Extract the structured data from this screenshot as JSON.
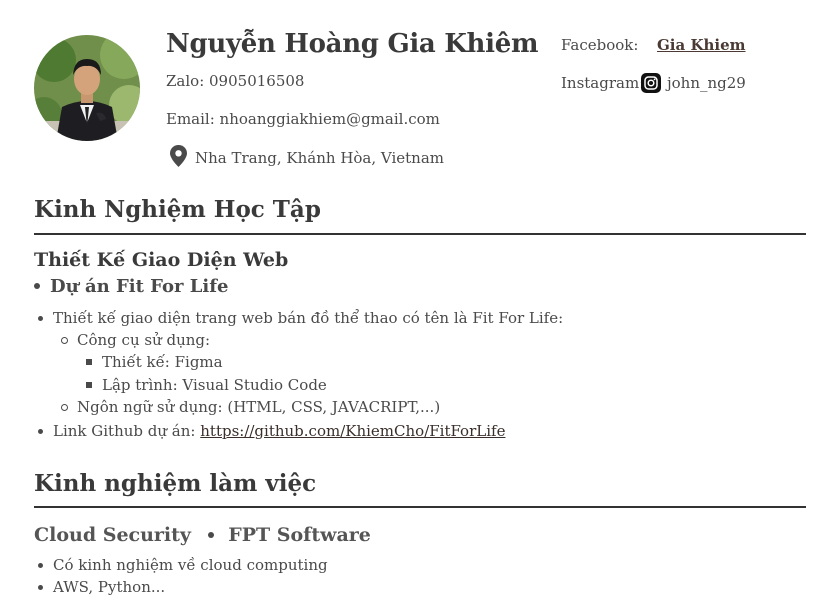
{
  "profile": {
    "name": "Nguyễn Hoàng Gia Khiêm",
    "zalo": "Zalo: 0905016508",
    "email": "Email: nhoanggiakhiem@gmail.com",
    "location": "Nha Trang, Khánh Hòa, Vietnam",
    "facebook_label": "Facebook:",
    "facebook_value": "Gia Khiem",
    "instagram_label": "Instagram:",
    "instagram_value": "john_ng29"
  },
  "education": {
    "title": "Kinh Nghiệm Học Tập",
    "subtitle": "Thiết Kế Giao Diện Web",
    "project": "Dự án Fit For Life",
    "items": {
      "desc": "Thiết kế giao diện trang web bán đồ thể thao có tên là Fit For Life:",
      "tools": "Công cụ sử dụng:",
      "tool_design": "Thiết kế: Figma",
      "tool_code": "Lập trình: Visual Studio Code",
      "languages": "Ngôn ngữ sử dụng: (HTML, CSS, JAVACRIPT,...)",
      "github_label": "Link Github dự án:",
      "github_url": "https://github.com/KhiemCho/FitForLife"
    }
  },
  "work": {
    "title": "Kinh nghiệm làm việc",
    "role": "Cloud Security",
    "company": "FPT Software",
    "items": [
      "Có kinh nghiệm về cloud computing",
      "AWS, Python..."
    ]
  },
  "icons": {
    "location": "map-pin-icon",
    "instagram": "instagram-icon"
  },
  "colors": {
    "text": "#3a3a3a",
    "rule": "#333333",
    "pin": "#4a4a4a"
  }
}
